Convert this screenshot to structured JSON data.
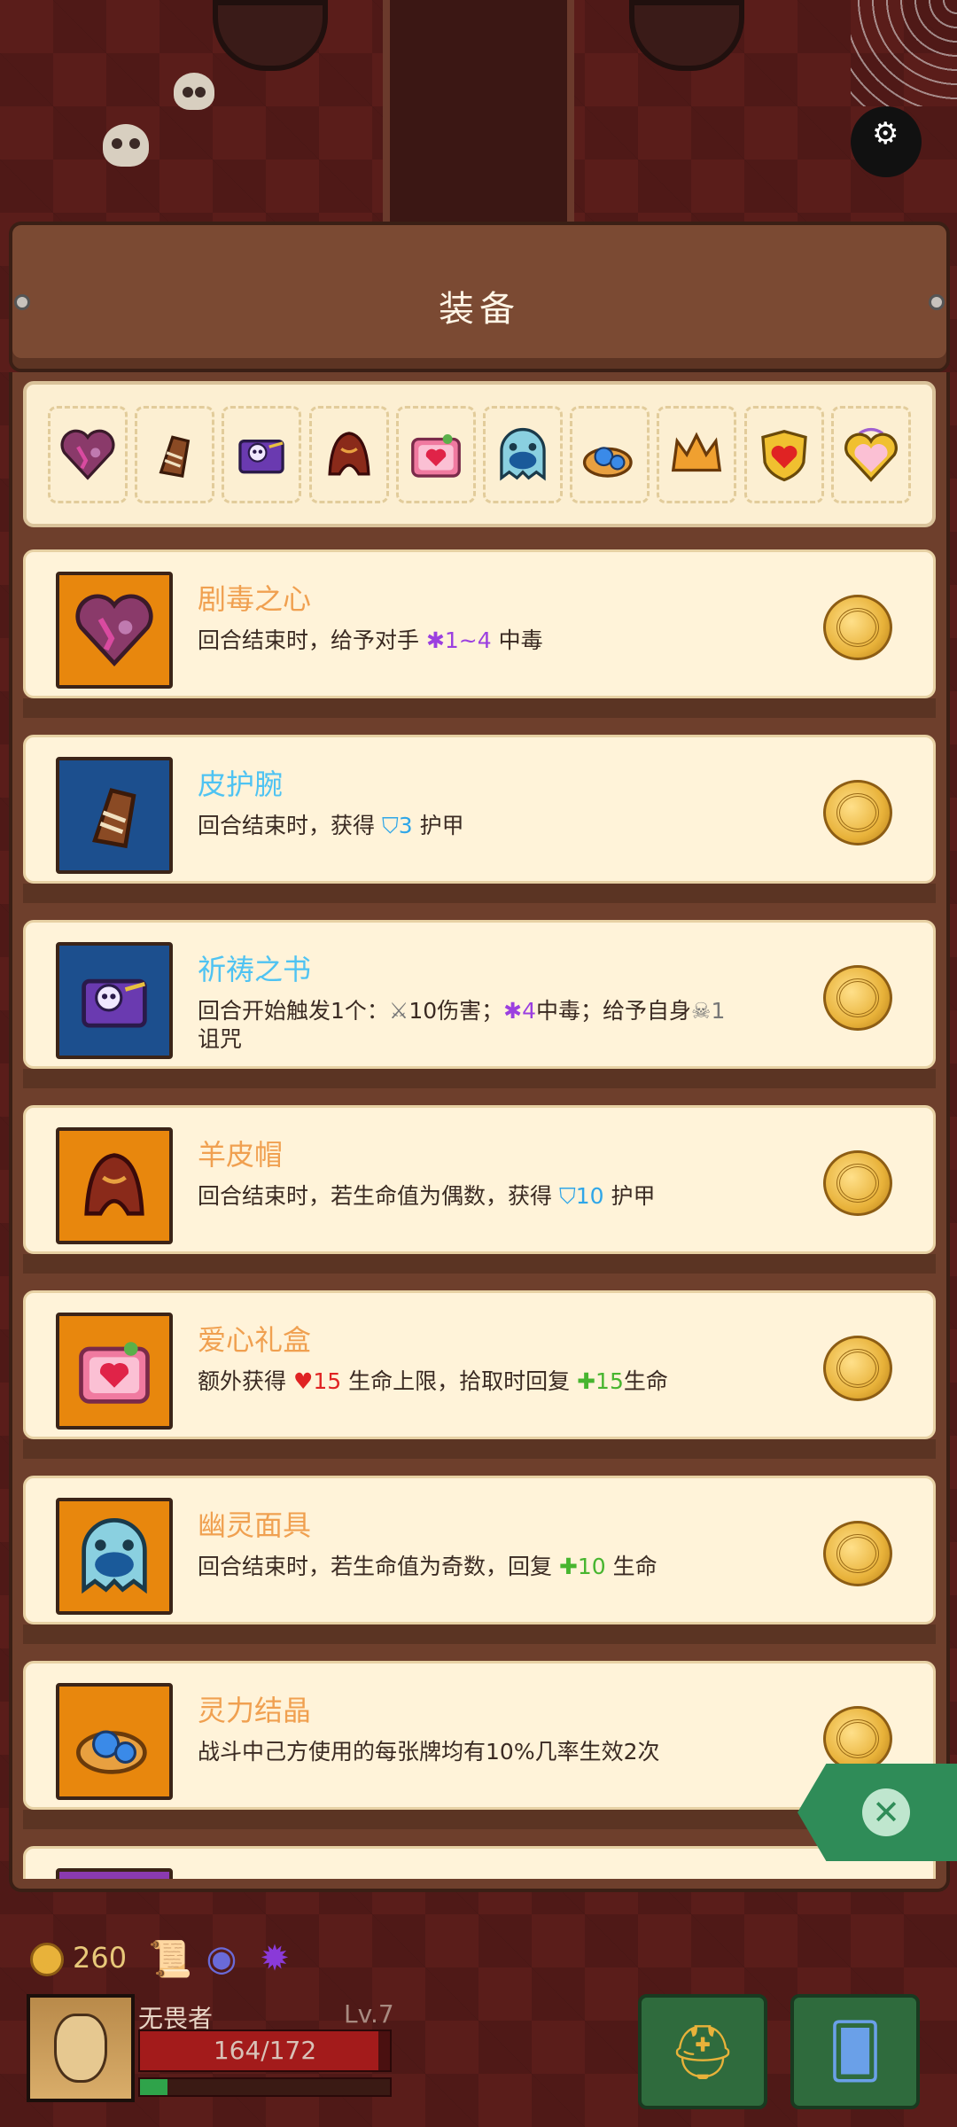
{
  "panel": {
    "title": "装备"
  },
  "equipment_bar": {
    "icons": [
      "poison-heart-icon",
      "leather-bracer-icon",
      "prayer-book-icon",
      "sheepskin-hat-icon",
      "love-gift-box-icon",
      "ghost-mask-icon",
      "spirit-crystal-icon",
      "crown-icon",
      "heart-shield-icon",
      "heart-locket-icon"
    ]
  },
  "items": [
    {
      "name": "剧毒之心",
      "name_color": "#f0a050",
      "thumb_bg": "orange",
      "icon": "poison-heart-icon",
      "desc": {
        "pre": "回合结束时，给予对手 ",
        "icon1": "poison-icon",
        "val1": "1~4",
        "mid": " 中毒",
        "icon2": "",
        "val2": "",
        "post": ""
      },
      "val_color": "purple"
    },
    {
      "name": "皮护腕",
      "name_color": "#4fc3f2",
      "thumb_bg": "blue",
      "icon": "leather-bracer-icon",
      "desc": {
        "pre": "回合结束时，获得 ",
        "icon1": "shield-icon",
        "val1": "3",
        "mid": " 护甲",
        "icon2": "",
        "val2": "",
        "post": ""
      },
      "val_color": "blue"
    },
    {
      "name": "祈祷之书",
      "name_color": "#4fc3f2",
      "thumb_bg": "blue",
      "icon": "prayer-book-icon",
      "desc": {
        "pre": "回合开始触发1个：",
        "icon1": "sword-icon",
        "val1": "10伤害；",
        "mid": "",
        "icon2": "poison-icon",
        "val2": "4",
        "post": "中毒；给予自身",
        "icon3": "skull-icon",
        "val3": "1",
        "tail": "诅咒"
      },
      "val_color": "mixed"
    },
    {
      "name": "羊皮帽",
      "name_color": "#f0a050",
      "thumb_bg": "orange",
      "icon": "sheepskin-hat-icon",
      "desc": {
        "pre": "回合结束时，若生命值为偶数，获得 ",
        "icon1": "shield-icon",
        "val1": "10",
        "mid": " 护甲",
        "icon2": "",
        "val2": "",
        "post": ""
      },
      "val_color": "blue"
    },
    {
      "name": "爱心礼盒",
      "name_color": "#f0a050",
      "thumb_bg": "orange",
      "icon": "love-gift-box-icon",
      "desc": {
        "pre": "额外获得 ",
        "icon1": "heart-icon",
        "val1": "15",
        "mid": " 生命上限，拾取时回复 ",
        "icon2": "plus-icon",
        "val2": "15",
        "post": "生命"
      },
      "val_color": "redgreen"
    },
    {
      "name": "幽灵面具",
      "name_color": "#f0a050",
      "thumb_bg": "orange",
      "icon": "ghost-mask-icon",
      "desc": {
        "pre": "回合结束时，若生命值为奇数，回复 ",
        "icon1": "plus-icon",
        "val1": "10",
        "mid": " 生命",
        "icon2": "",
        "val2": "",
        "post": ""
      },
      "val_color": "green"
    },
    {
      "name": "灵力结晶",
      "name_color": "#f0a050",
      "thumb_bg": "orange",
      "icon": "spirit-crystal-icon",
      "desc": {
        "pre": "战斗中己方使用的每张牌均有10%几率生效2次",
        "icon1": "",
        "val1": "",
        "mid": "",
        "icon2": "",
        "val2": "",
        "post": ""
      },
      "val_color": "none"
    }
  ],
  "hud": {
    "gold": "260",
    "icons": [
      "map-scroll-icon",
      "eye-icon",
      "dark-orb-icon"
    ],
    "player_name": "无畏者",
    "level": "Lv.7",
    "hp_text": "164/172",
    "hp_current": 164,
    "hp_max": 172,
    "xp_ratio": 0.11,
    "buttons": [
      "helmet-icon",
      "card-deck-icon"
    ]
  },
  "colors": {
    "accent_orange": "#e8870d",
    "accent_blue": "#1c4f8e",
    "close_green": "#2f8c58"
  }
}
